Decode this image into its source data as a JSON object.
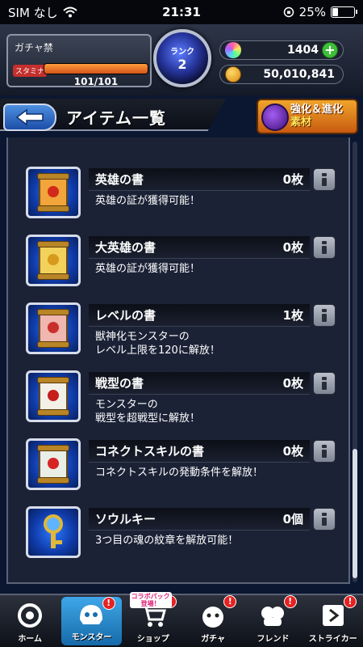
{
  "status_bar": {
    "carrier": "SIM なし",
    "time": "21:31",
    "battery": "25%",
    "battery_level": 0.25
  },
  "header": {
    "gacha_label": "ガチャ禁",
    "stamina_label": "スタミナ",
    "stamina_value": "101/101",
    "stamina_fraction": 1.0,
    "rank_label": "ランク",
    "rank_value": "2",
    "orbs": "1404",
    "coins": "50,010,841",
    "plus_label": "+"
  },
  "titlebar": {
    "title": "アイテム一覧",
    "enhance_label_line1": "強化＆進化",
    "enhance_label_line2": "素材"
  },
  "items": [
    {
      "name": "英雄の書",
      "count": "0枚",
      "desc": "英雄の証が獲得可能！",
      "color": "#f2a53a",
      "emblem": "#d22a1a"
    },
    {
      "name": "大英雄の書",
      "count": "0枚",
      "desc": "英雄の証が獲得可能！",
      "color": "#f3d25c",
      "emblem": "#d89a1c"
    },
    {
      "name": "レベルの書",
      "count": "1枚",
      "desc": "獣神化モンスターの\nレベル上限を120に解放！",
      "color": "#f0b6b0",
      "emblem": "#c9302c"
    },
    {
      "name": "戦型の書",
      "count": "0枚",
      "desc": "モンスターの\n戦型を超戦型に解放！",
      "color": "#f3f0e8",
      "emblem": "#c61d1d"
    },
    {
      "name": "コネクトスキルの書",
      "count": "0枚",
      "desc": "コネクトスキルの発動条件を解放！",
      "color": "#e9efe6",
      "emblem": "#d62424"
    },
    {
      "name": "ソウルキー",
      "count": "0個",
      "desc": "3つ目の魂の紋章を解放可能！",
      "color": "#e0b83a",
      "emblem": "#5fb4ff"
    }
  ],
  "bottom_nav": [
    {
      "label": "ホーム",
      "badge": ""
    },
    {
      "label": "モンスター",
      "badge": "!"
    },
    {
      "label": "ショップ",
      "badge": "!",
      "tag": "コラボパック\n登場！"
    },
    {
      "label": "ガチャ",
      "badge": "!"
    },
    {
      "label": "フレンド",
      "badge": "!"
    },
    {
      "label": "ストライカー",
      "badge": "!"
    }
  ]
}
